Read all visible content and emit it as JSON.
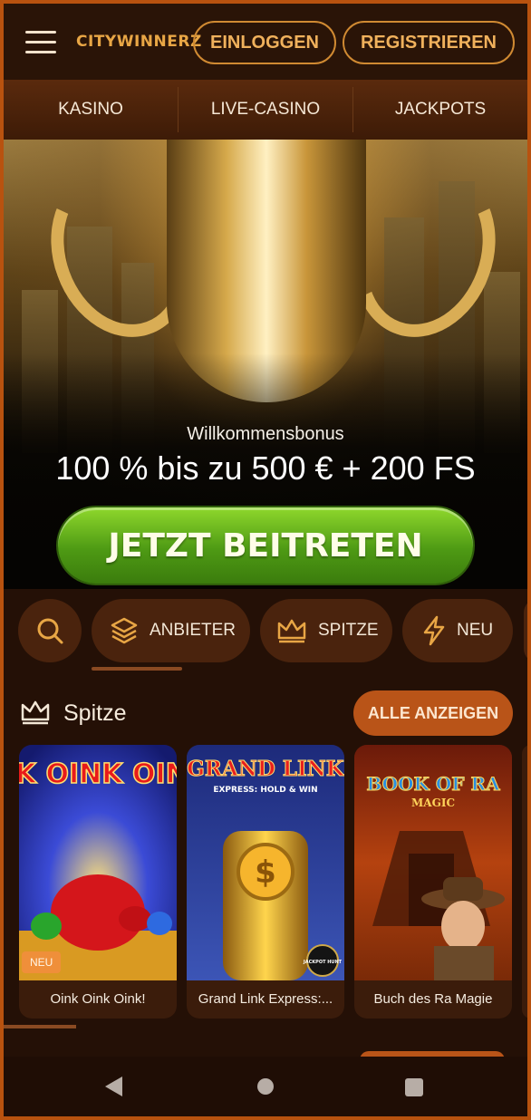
{
  "header": {
    "logo": "CITYWINNERZ",
    "login_label": "EINLOGGEN",
    "register_label": "REGISTRIEREN"
  },
  "nav": {
    "items": [
      {
        "label": "KASINO"
      },
      {
        "label": "LIVE-CASINO"
      },
      {
        "label": "JACKPOTS"
      }
    ]
  },
  "hero": {
    "subtitle": "Willkommensbonus",
    "title": "100 % bis zu 500 € + 200 FS",
    "cta_label": "JETZT BEITRETEN"
  },
  "filters": {
    "search_icon": "search-icon",
    "items": [
      {
        "label": "ANBIETER",
        "icon": "layers-icon"
      },
      {
        "label": "SPITZE",
        "icon": "crown-icon"
      },
      {
        "label": "NEU",
        "icon": "lightning-icon"
      }
    ]
  },
  "section": {
    "title": "Spitze",
    "icon": "crown-icon",
    "show_all_label": "ALLE ANZEIGEN"
  },
  "games": [
    {
      "name": "Oink Oink Oink!",
      "badge": "NEU",
      "art_title": "OINK OINK OINK™"
    },
    {
      "name": "Grand Link Express:...",
      "art_title": "GRAND LINK",
      "art_subtitle": "EXPRESS: HOLD & WIN",
      "art_tag": "JACKPOT HUNT"
    },
    {
      "name": "Buch des Ra Magie",
      "art_title": "BOOK OF RA",
      "art_subtitle": "MAGIC"
    }
  ],
  "colors": {
    "accent": "#d08a32",
    "brand_orange": "#b95418",
    "cta_green": "#5aae1a",
    "background": "#241006"
  }
}
